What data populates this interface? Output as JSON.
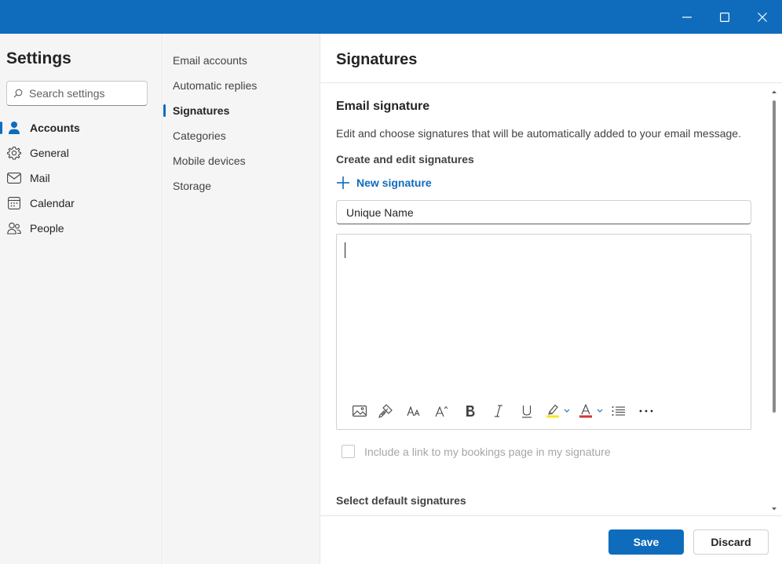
{
  "window": {
    "controls": [
      "minimize-icon",
      "maximize-icon",
      "close-icon"
    ],
    "accent": "#0f6cbd"
  },
  "settings": {
    "title": "Settings",
    "search_placeholder": "Search settings",
    "nav": [
      {
        "label": "Accounts",
        "icon": "person-icon",
        "active": true
      },
      {
        "label": "General",
        "icon": "gear-icon",
        "active": false
      },
      {
        "label": "Mail",
        "icon": "mail-icon",
        "active": false
      },
      {
        "label": "Calendar",
        "icon": "calendar-icon",
        "active": false
      },
      {
        "label": "People",
        "icon": "people-icon",
        "active": false
      }
    ]
  },
  "accounts_menu": {
    "items": [
      {
        "label": "Email accounts",
        "active": false
      },
      {
        "label": "Automatic replies",
        "active": false
      },
      {
        "label": "Signatures",
        "active": true
      },
      {
        "label": "Categories",
        "active": false
      },
      {
        "label": "Mobile devices",
        "active": false
      },
      {
        "label": "Storage",
        "active": false
      }
    ]
  },
  "signatures": {
    "page_title": "Signatures",
    "section_title": "Email signature",
    "description": "Edit and choose signatures that will be automatically added to your email message.",
    "create_edit_label": "Create and edit signatures",
    "new_signature_label": "New signature",
    "name_value": "Unique Name",
    "editor_body": "",
    "toolbar_icons": [
      "insert-picture-icon",
      "format-painter-icon",
      "font-size-icon",
      "grow-font-icon",
      "bold-icon",
      "italic-icon",
      "underline-icon",
      "highlight-icon",
      "font-color-icon",
      "bullets-icon",
      "more-options-icon"
    ],
    "bookings_checkbox_label": "Include a link to my bookings page in my signature",
    "bookings_checked": false,
    "default_signatures_title": "Select default signatures"
  },
  "footer": {
    "save_label": "Save",
    "discard_label": "Discard"
  }
}
